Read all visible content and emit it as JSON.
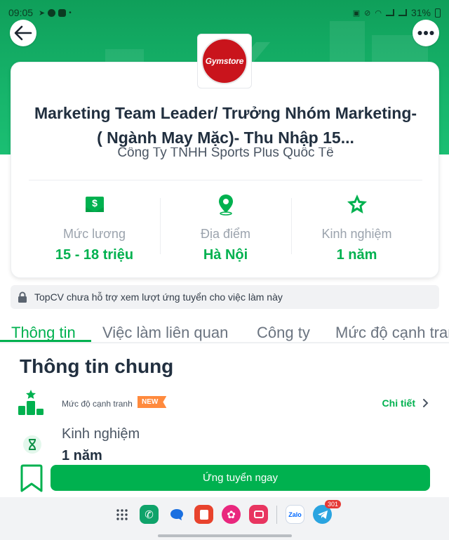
{
  "status_bar": {
    "time": "09:05",
    "battery": "31%"
  },
  "job": {
    "logo_text": "Gymstore",
    "title": "Marketing Team Leader/ Trưởng Nhóm Marketing- ( Ngành May Mặc)- Thu Nhập 15...",
    "company": "Công Ty TNHH Sports Plus Quốc Tế",
    "stats": [
      {
        "label": "Mức lương",
        "value": "15 - 18 triệu",
        "icon": "money-icon"
      },
      {
        "label": "Địa điểm",
        "value": "Hà Nội",
        "icon": "location-pin-icon"
      },
      {
        "label": "Kinh nghiệm",
        "value": "1 năm",
        "icon": "star-badge-icon"
      }
    ]
  },
  "notice": {
    "text": "TopCV chưa hỗ trợ xem lượt ứng tuyển cho việc làm này"
  },
  "tabs": [
    {
      "label": "Thông tin",
      "active": true
    },
    {
      "label": "Việc làm liên quan",
      "active": false
    },
    {
      "label": "Công ty",
      "active": false
    },
    {
      "label": "Mức độ cạnh tranh",
      "active": false
    }
  ],
  "section": {
    "title": "Thông tin chung",
    "competition_label": "Mức độ cạnh tranh",
    "new_badge": "NEW",
    "detail_link": "Chi tiết",
    "experience_label": "Kinh nghiệm",
    "experience_value": "1 năm"
  },
  "actions": {
    "apply_label": "Ứng tuyển ngay"
  },
  "dock": {
    "telegram_badge": "301",
    "zalo_label": "Zalo"
  },
  "colors": {
    "brand_green": "#00b14f",
    "badge_orange": "#ff8a3d",
    "logo_red": "#c9141c"
  }
}
